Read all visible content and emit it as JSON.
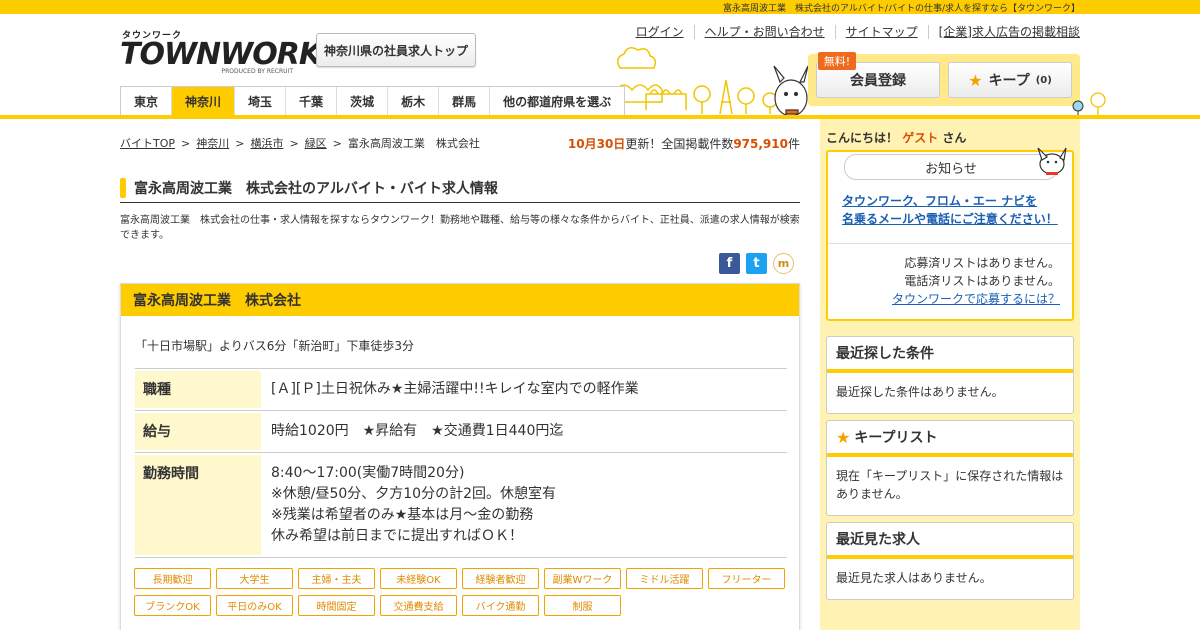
{
  "page_title_bar": "富永高周波工業　株式会社のアルバイト/バイトの仕事/求人を探すなら【タウンワーク】",
  "logo": {
    "kana": "タウンワーク",
    "word": "TOWNWORK",
    "produced": "PRODUCED BY RECRUIT"
  },
  "pref_top_button": "神奈川県の社員求人トップ",
  "header_links": [
    "ログイン",
    "ヘルプ・お問い合わせ",
    "サイトマップ",
    "[企業]求人広告の掲載相談"
  ],
  "member": {
    "free_badge": "無料!",
    "register_label": "会員登録",
    "keep_label": "キープ",
    "keep_count": "(0)"
  },
  "nav": {
    "items": [
      "東京",
      "神奈川",
      "埼玉",
      "千葉",
      "茨城",
      "栃木",
      "群馬",
      "他の都道府県を選ぶ"
    ],
    "active": "神奈川"
  },
  "breadcrumb": {
    "items": [
      "バイトTOP",
      "神奈川",
      "横浜市",
      "緑区"
    ],
    "current": "富永高周波工業　株式会社",
    "separator": ">"
  },
  "update": {
    "date": "10月30日",
    "label_mid": "更新！全国掲載件数",
    "count": "975,910",
    "unit": "件"
  },
  "heading": "富永高周波工業　株式会社のアルバイト・バイト求人情報",
  "description": "富永高周波工業　株式会社の仕事・求人情報を探すならタウンワーク！勤務地や職種、給与等の様々な条件からバイト、正社員、派遣の求人情報が検索できます。",
  "social_icons": [
    "facebook-icon",
    "twitter-icon",
    "mixi-icon"
  ],
  "job": {
    "company": "富永高周波工業　株式会社",
    "access": "「十日市場駅」よりバス6分「新治町」下車徒歩3分",
    "rows": [
      {
        "label": "職種",
        "lines": [
          "[Ａ][Ｐ]土日祝休み★主婦活躍中!!キレイな室内での軽作業"
        ]
      },
      {
        "label": "給与",
        "lines": [
          "時給1020円　★昇給有　★交通費1日440円迄"
        ]
      },
      {
        "label": "勤務時間",
        "lines": [
          "8:40～17:00(実働7時間20分)",
          "※休憩/昼50分、夕方10分の計2回。休憩室有",
          "※残業は希望者のみ★基本は月～金の勤務",
          "休み希望は前日までに提出すればＯＫ！"
        ]
      }
    ],
    "tags": [
      "長期歓迎",
      "大学生",
      "主婦・主夫",
      "未経験OK",
      "経験者歓迎",
      "副業Wワーク",
      "ミドル活躍",
      "フリーター",
      "ブランクOK",
      "平日のみOK",
      "時間固定",
      "交通費支給",
      "バイク通勤",
      "制服"
    ]
  },
  "sidebar": {
    "greeting_prefix": "こんにちは！",
    "greeting_name": "ゲスト",
    "greeting_suffix": "さん",
    "notice_title": "お知らせ",
    "notice_warning_1": "タウンワーク、フロム・エー ナビを",
    "notice_warning_2": "名乗るメールや電話にご注意ください！",
    "applied_none": "応募済リストはありません。",
    "called_none": "電話済リストはありません。",
    "how_to_apply": "タウンワークで応募するには？",
    "recent_search_title": "最近探した条件",
    "recent_search_body": "最近探した条件はありません。",
    "keep_list_title": "キープリスト",
    "keep_list_body": "現在「キープリスト」に保存された情報はありません。",
    "recent_view_title": "最近見た求人",
    "recent_view_body": "最近見た求人はありません。"
  },
  "colors": {
    "brand_yellow": "#ffcc00",
    "accent_orange": "#d94f00",
    "link_blue": "#1a5fb4",
    "tag_orange": "#f0a200"
  }
}
